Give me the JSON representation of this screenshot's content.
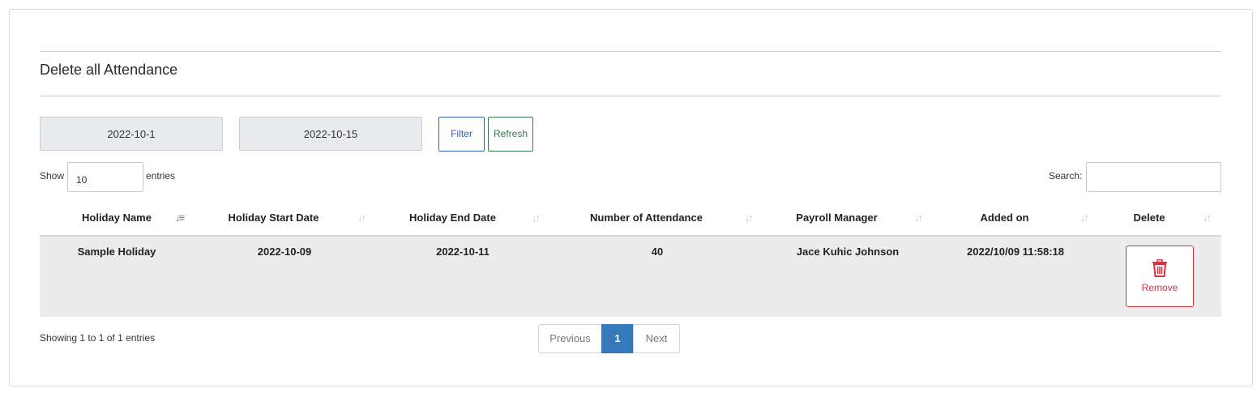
{
  "page": {
    "title": "Delete all Attendance"
  },
  "filters": {
    "start_date": "2022-10-1",
    "end_date": "2022-10-15",
    "filter_label": "Filter",
    "refresh_label": "Refresh"
  },
  "table_controls": {
    "show_label": "Show",
    "entries_value": "10",
    "entries_label": "entries",
    "search_label": "Search:"
  },
  "table": {
    "headers": [
      "Holiday Name",
      "Holiday Start Date",
      "Holiday End Date",
      "Number of Attendance",
      "Payroll Manager",
      "Added on",
      "Delete"
    ],
    "rows": [
      {
        "holiday_name": "Sample Holiday",
        "start_date": "2022-10-09",
        "end_date": "2022-10-11",
        "attendance": "40",
        "manager": "Jace Kuhic Johnson",
        "added_on": "2022/10/09 11:58:18",
        "delete_label": "Remove"
      }
    ]
  },
  "footer": {
    "info": "Showing 1 to 1 of 1 entries",
    "previous": "Previous",
    "current_page": "1",
    "next": "Next"
  },
  "colors": {
    "accent": "#3579b8",
    "danger": "#d9303e",
    "filter": "#2f62a8",
    "refresh": "#2f7a4f"
  }
}
